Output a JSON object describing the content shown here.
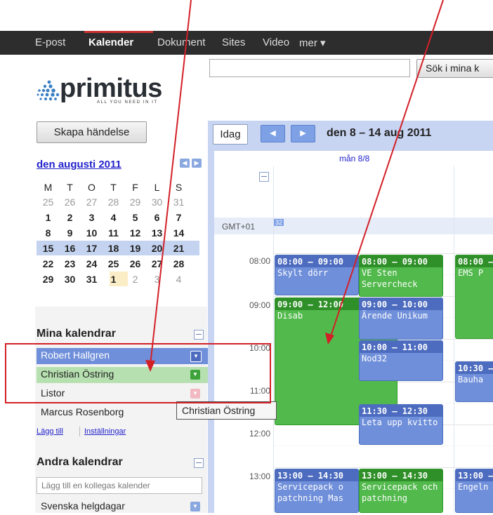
{
  "topnav": {
    "items": [
      "E-post",
      "Kalender",
      "Dokument",
      "Sites",
      "Video",
      "mer ▾"
    ],
    "active": "Kalender"
  },
  "search": {
    "placeholder": "",
    "button_label": "Sök i mina k"
  },
  "logo": {
    "text": "primitus",
    "tagline": "ALL YOU NEED IN IT"
  },
  "create_button": "Skapa händelse",
  "mini_calendar": {
    "title": "den augusti 2011",
    "weekdays": [
      "M",
      "T",
      "O",
      "T",
      "F",
      "L",
      "S"
    ],
    "weeks": [
      [
        "25",
        "26",
        "27",
        "28",
        "29",
        "30",
        "31"
      ],
      [
        "1",
        "2",
        "3",
        "4",
        "5",
        "6",
        "7"
      ],
      [
        "8",
        "9",
        "10",
        "11",
        "12",
        "13",
        "14"
      ],
      [
        "15",
        "16",
        "17",
        "18",
        "19",
        "20",
        "21"
      ],
      [
        "22",
        "23",
        "24",
        "25",
        "26",
        "27",
        "28"
      ],
      [
        "29",
        "30",
        "31",
        "1",
        "2",
        "3",
        "4"
      ]
    ]
  },
  "my_calendars": {
    "title": "Mina kalendrar",
    "items": [
      {
        "label": "Robert Hallgren"
      },
      {
        "label": "Christian Östring"
      },
      {
        "label": "Listor"
      },
      {
        "label": "Marcus Rosenborg"
      }
    ],
    "add_link": "Lägg till",
    "settings_link": "Inställningar"
  },
  "other_calendars": {
    "title": "Andra kalendrar",
    "input_placeholder": "Lägg till en kollegas kalender",
    "items": [
      {
        "label": "Svenska helgdagar"
      }
    ]
  },
  "tooltip": "Christian Östring",
  "toolbar": {
    "today_label": "Idag",
    "date_range": "den 8 – 14 aug 2011"
  },
  "day_header": "mån 8/8",
  "timezone_label": "GMT+01",
  "week_number": "32",
  "hours": [
    "08:00",
    "09:00",
    "10:00",
    "11:00",
    "12:00",
    "13:00"
  ],
  "events": [
    {
      "time": "08:00 – 09:00",
      "title": "Skylt dörr"
    },
    {
      "time": "08:00 – 09:00",
      "title": "VE Sten Servercheck"
    },
    {
      "time": "08:00 –",
      "title": "EMS P"
    },
    {
      "time": "09:00 – 12:00",
      "title": "Disab"
    },
    {
      "time": "09:00 – 10:00",
      "title": "Ärende Unikum"
    },
    {
      "time": "10:00 – 11:00",
      "title": "Nod32"
    },
    {
      "time": "10:30 –",
      "title": "Bauha"
    },
    {
      "time": "11:30 – 12:30",
      "title": "Leta upp kvitto"
    },
    {
      "time": "13:00 – 14:30",
      "title": "Servicepack o patchning Mas"
    },
    {
      "time": "13:00 – 14:30",
      "title": "Servicepack och patchning"
    },
    {
      "time": "13:00 –",
      "title": "Engeln"
    }
  ],
  "colors": {
    "topbar": "#2d2d2d",
    "event_blue": "#6f8fda",
    "event_green": "#52b94c",
    "calendar_robert": "#6f8fda",
    "calendar_christian": "#b7e0b0",
    "annotation_red": "#d32027"
  }
}
